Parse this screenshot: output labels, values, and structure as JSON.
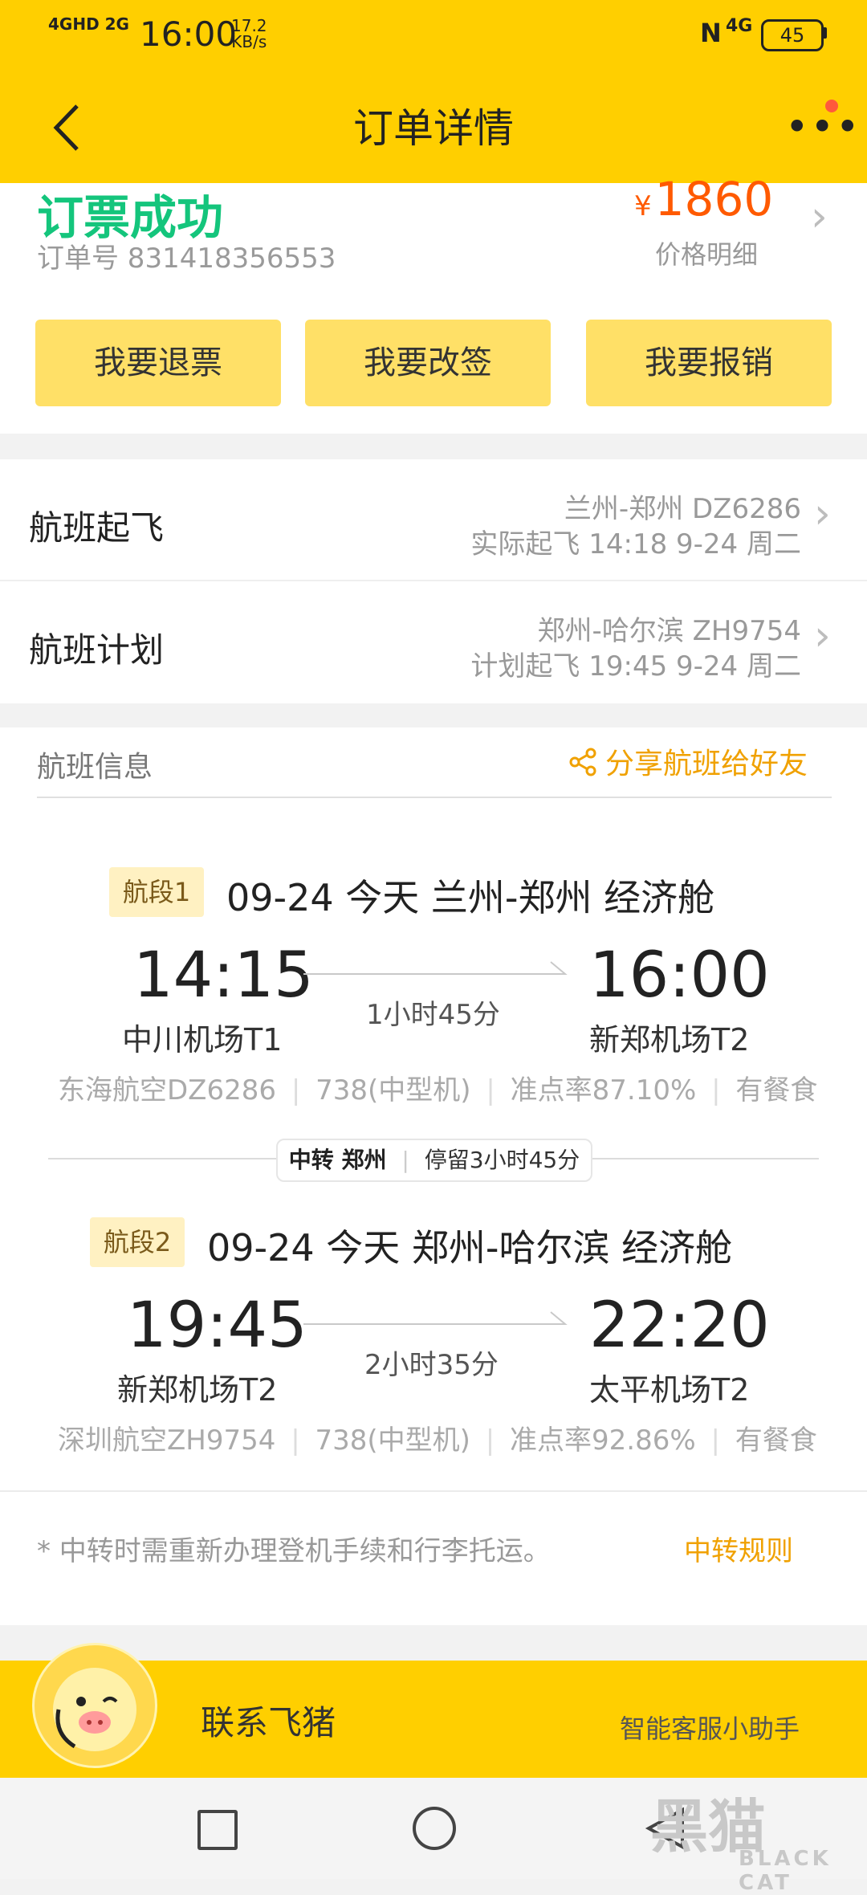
{
  "status_bar": {
    "network": "4GHD 2G",
    "time": "16:00",
    "speed": "17.2",
    "speed_unit": "KB/s",
    "signal_right": "4G",
    "battery": "45"
  },
  "header": {
    "title": "订单详情"
  },
  "order": {
    "status": "订票成功",
    "order_number": "订单号 831418356553",
    "currency": "¥",
    "price": "1860",
    "price_detail": "价格明细"
  },
  "actions": [
    {
      "label": "我要退票"
    },
    {
      "label": "我要改签"
    },
    {
      "label": "我要报销"
    }
  ],
  "flight_status_rows": [
    {
      "label": "航班起飞",
      "route": "兰州-郑州 DZ6286",
      "detail": "实际起飞 14:18 9-24 周二"
    },
    {
      "label": "航班计划",
      "route": "郑州-哈尔滨 ZH9754",
      "detail": "计划起飞 19:45 9-24 周二"
    }
  ],
  "flight_info": {
    "title": "航班信息",
    "share_label": "分享航班给好友",
    "segments": [
      {
        "badge": "航段1",
        "summary": "09-24 今天 兰州-郑州 经济舱",
        "dep_time": "14:15",
        "dep_airport": "中川机场T1",
        "duration": "1小时45分",
        "arr_time": "16:00",
        "arr_airport": "新郑机场T2",
        "airline": "东海航空DZ6286",
        "aircraft": "738(中型机)",
        "ontime": "准点率87.10%",
        "meal": "有餐食"
      },
      {
        "badge": "航段2",
        "summary": "09-24 今天 郑州-哈尔滨 经济舱",
        "dep_time": "19:45",
        "dep_airport": "新郑机场T2",
        "duration": "2小时35分",
        "arr_time": "22:20",
        "arr_airport": "太平机场T2",
        "airline": "深圳航空ZH9754",
        "aircraft": "738(中型机)",
        "ontime": "准点率92.86%",
        "meal": "有餐食"
      }
    ],
    "transfer": {
      "city": "中转 郑州",
      "stay": "停留3小时45分"
    },
    "notice": "* 中转时需重新办理登机手续和行李托运。",
    "rule_link": "中转规则"
  },
  "contact_bar": {
    "name": "联系飞猪",
    "subtitle": "智能客服小助手"
  },
  "watermark": {
    "cn": "黑猫",
    "en": "BLACK CAT"
  },
  "colors": {
    "brand_yellow": "#ffcf00",
    "button_yellow": "#ffe067",
    "success_green": "#14c57c",
    "price_orange": "#ff5a00",
    "link_orange": "#f0a100"
  }
}
